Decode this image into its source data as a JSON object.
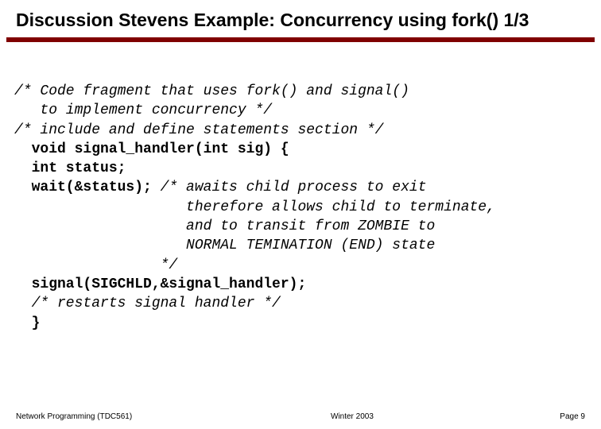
{
  "title": "Discussion Stevens Example: Concurrency using fork()  1/3",
  "code": {
    "l1": "/* Code fragment that uses fork() and signal()",
    "l2": "   to implement concurrency */",
    "l3": "/* include and define statements section */",
    "l4": "  void signal_handler(int sig) {",
    "l5": "  int status;",
    "l6": "  wait(&status); ",
    "l6c": "/* awaits child process to exit",
    "l7": "                    therefore allows child to terminate,",
    "l8": "                    and to transit from ZOMBIE to",
    "l9": "                    NORMAL TEMINATION (END) state",
    "l10": "                 */",
    "l11": "  signal(SIGCHLD,&signal_handler);",
    "l12": "  /* restarts signal handler */",
    "l13": "  }"
  },
  "footer": {
    "left": "Network Programming (TDC561)",
    "center": "Winter 2003",
    "right": "Page 9"
  }
}
